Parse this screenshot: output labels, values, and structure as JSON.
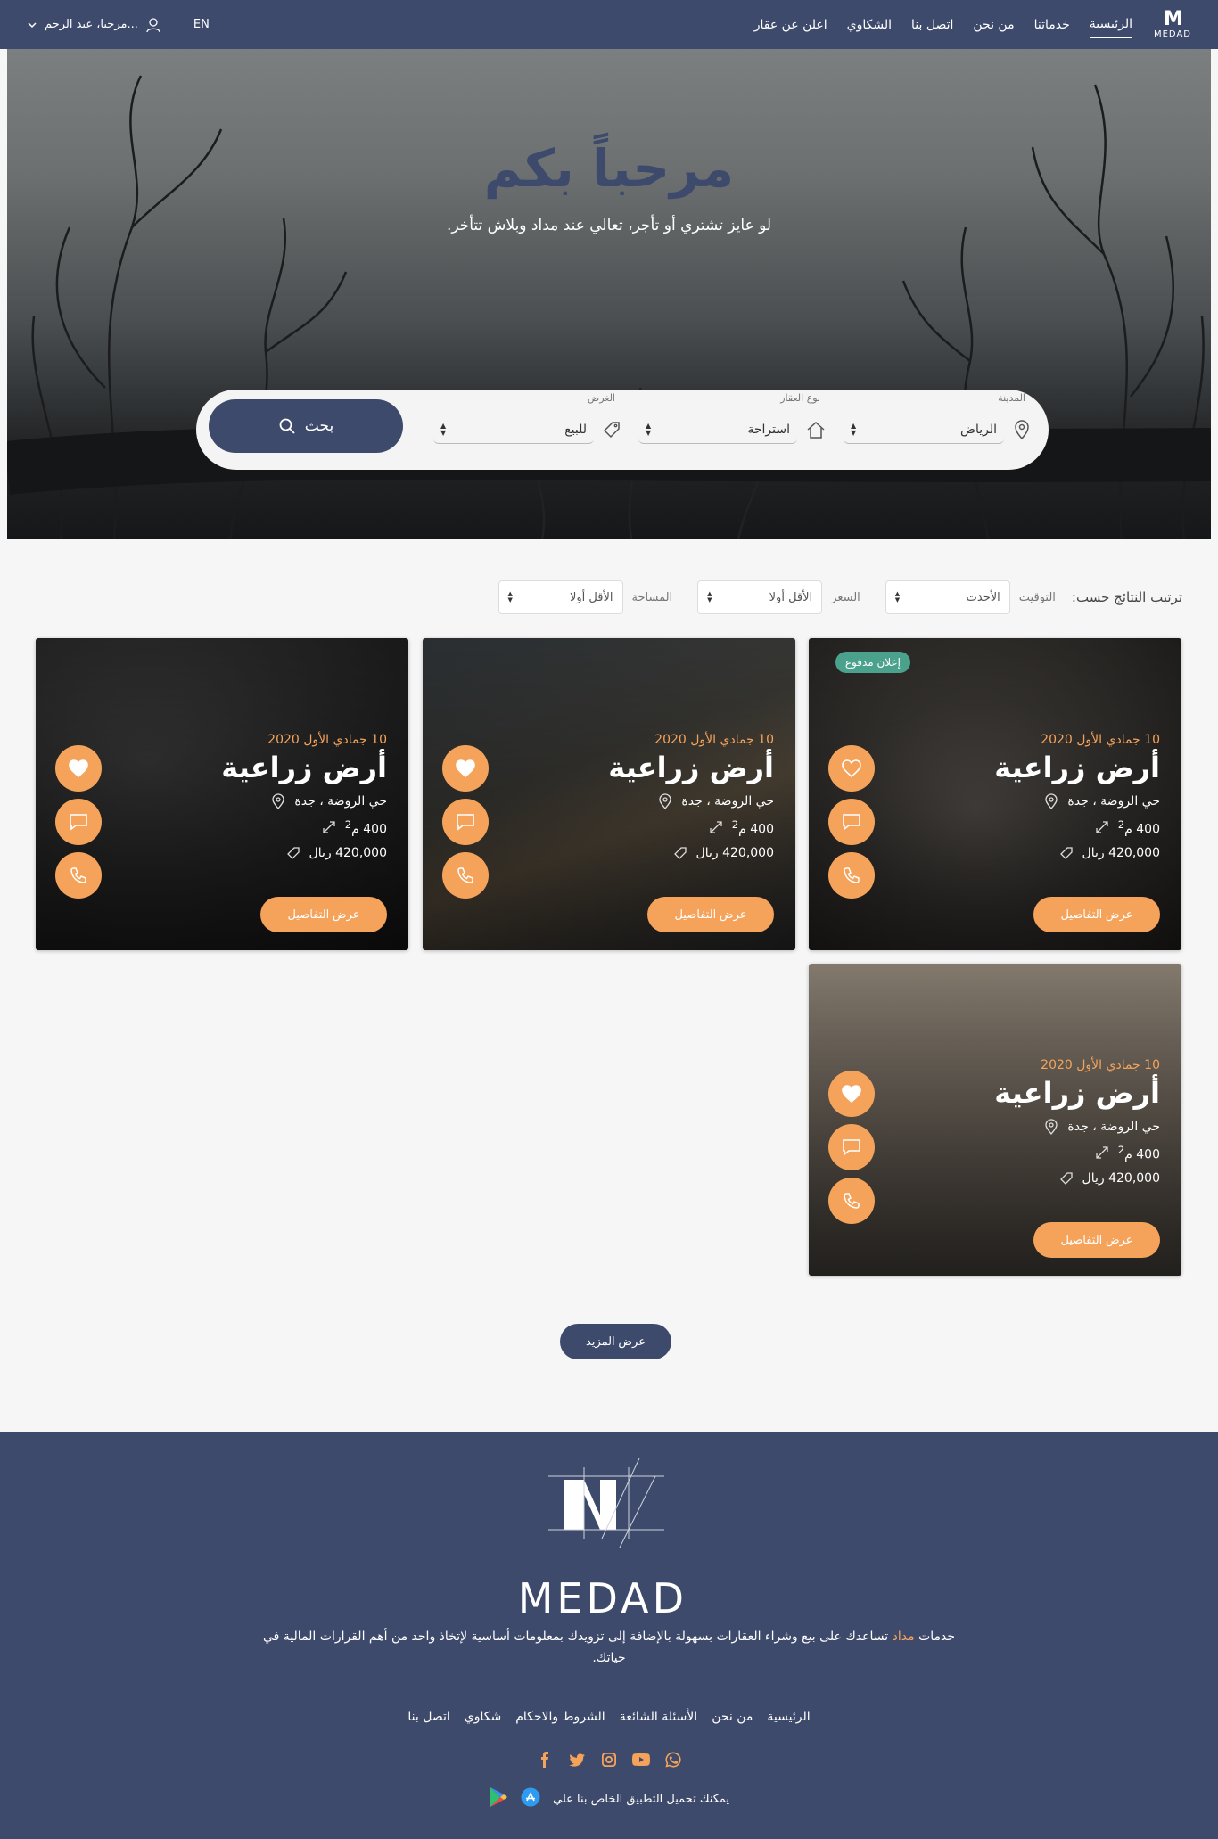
{
  "header": {
    "logo_word": "MEDAD",
    "nav": [
      {
        "label": "الرئيسية",
        "active": true
      },
      {
        "label": "خدماتنا",
        "active": false
      },
      {
        "label": "من نحن",
        "active": false
      },
      {
        "label": "اتصل بنا",
        "active": false
      },
      {
        "label": "الشكاوي",
        "active": false
      },
      {
        "label": "اعلن عن عقار",
        "active": false
      }
    ],
    "lang": "EN",
    "greeting": "مرحبا، عبد الرحم..."
  },
  "hero": {
    "title": "مرحباً بكم",
    "subtitle": "لو عايز تشتري أو تأجر، تعالي عند مداد وبلاش تتأخر."
  },
  "search": {
    "city_label": "المدينة",
    "city_value": "الرياض",
    "type_label": "نوع العقار",
    "type_value": "استراحة",
    "purpose_label": "الغرض",
    "purpose_value": "للبيع",
    "button_label": "بحث"
  },
  "sort": {
    "title": "ترتيب النتائج حسب:",
    "time_label": "التوقيت",
    "time_value": "الأحدث",
    "price_label": "السعر",
    "price_value": "الأقل أولا",
    "area_label": "المساحة",
    "area_value": "الأقل أولا"
  },
  "cards": [
    {
      "date": "10 جمادي الأول 2020",
      "title": "أرض زراعية",
      "location": "حي الروضة ، جدة",
      "area": "400 م",
      "area_sup": "2",
      "price": "420,000 ريال",
      "details_label": "عرض التفاصيل",
      "paid_badge": "إعلان مدفوع",
      "favorited": false
    },
    {
      "date": "10 جمادي الأول 2020",
      "title": "أرض زراعية",
      "location": "حي الروضة ، جدة",
      "area": "400 م",
      "area_sup": "2",
      "price": "420,000 ريال",
      "details_label": "عرض التفاصيل",
      "paid_badge": "",
      "favorited": true
    },
    {
      "date": "10 جمادي الأول 2020",
      "title": "أرض زراعية",
      "location": "حي الروضة ، جدة",
      "area": "400 م",
      "area_sup": "2",
      "price": "420,000 ريال",
      "details_label": "عرض التفاصيل",
      "paid_badge": "",
      "favorited": true
    },
    {
      "date": "10 جمادي الأول 2020",
      "title": "أرض زراعية",
      "location": "حي الروضة ، جدة",
      "area": "400 م",
      "area_sup": "2",
      "price": "420,000 ريال",
      "details_label": "عرض التفاصيل",
      "paid_badge": "",
      "favorited": true
    }
  ],
  "more_label": "عرض المزيد",
  "footer": {
    "logo_word": "MEDAD",
    "desc_prefix": "خدمات",
    "desc_brand": "مداد",
    "desc_rest": "تساعدك على بيع وشراء العقارات بسهولة بالإضافة إلى تزويدك بمعلومات أساسية لإتخاذ واحد من أهم القرارات المالية في حياتك.",
    "links": [
      "الرئيسية",
      "من نحن",
      "الأسئلة الشائعة",
      "الشروط والاحكام",
      "شكاوي",
      "اتصل بنا"
    ],
    "social": [
      "facebook-icon",
      "twitter-icon",
      "instagram-icon",
      "youtube-icon",
      "whatsapp-icon"
    ],
    "app_text": "يمكنك تحميل التطبيق الخاص بنا علي"
  },
  "colors": {
    "primary": "#3e4a6c",
    "accent": "#f5a35a",
    "badge": "#4aa28d"
  }
}
